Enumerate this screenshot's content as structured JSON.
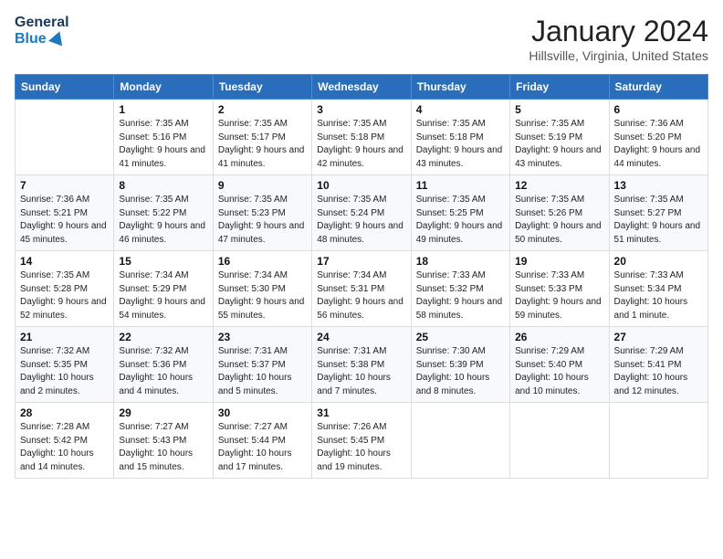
{
  "logo": {
    "line1": "General",
    "line2": "Blue"
  },
  "title": "January 2024",
  "location": "Hillsville, Virginia, United States",
  "weekdays": [
    "Sunday",
    "Monday",
    "Tuesday",
    "Wednesday",
    "Thursday",
    "Friday",
    "Saturday"
  ],
  "weeks": [
    [
      {
        "day": "",
        "sunrise": "",
        "sunset": "",
        "daylight": ""
      },
      {
        "day": "1",
        "sunrise": "Sunrise: 7:35 AM",
        "sunset": "Sunset: 5:16 PM",
        "daylight": "Daylight: 9 hours and 41 minutes."
      },
      {
        "day": "2",
        "sunrise": "Sunrise: 7:35 AM",
        "sunset": "Sunset: 5:17 PM",
        "daylight": "Daylight: 9 hours and 41 minutes."
      },
      {
        "day": "3",
        "sunrise": "Sunrise: 7:35 AM",
        "sunset": "Sunset: 5:18 PM",
        "daylight": "Daylight: 9 hours and 42 minutes."
      },
      {
        "day": "4",
        "sunrise": "Sunrise: 7:35 AM",
        "sunset": "Sunset: 5:18 PM",
        "daylight": "Daylight: 9 hours and 43 minutes."
      },
      {
        "day": "5",
        "sunrise": "Sunrise: 7:35 AM",
        "sunset": "Sunset: 5:19 PM",
        "daylight": "Daylight: 9 hours and 43 minutes."
      },
      {
        "day": "6",
        "sunrise": "Sunrise: 7:36 AM",
        "sunset": "Sunset: 5:20 PM",
        "daylight": "Daylight: 9 hours and 44 minutes."
      }
    ],
    [
      {
        "day": "7",
        "sunrise": "Sunrise: 7:36 AM",
        "sunset": "Sunset: 5:21 PM",
        "daylight": "Daylight: 9 hours and 45 minutes."
      },
      {
        "day": "8",
        "sunrise": "Sunrise: 7:35 AM",
        "sunset": "Sunset: 5:22 PM",
        "daylight": "Daylight: 9 hours and 46 minutes."
      },
      {
        "day": "9",
        "sunrise": "Sunrise: 7:35 AM",
        "sunset": "Sunset: 5:23 PM",
        "daylight": "Daylight: 9 hours and 47 minutes."
      },
      {
        "day": "10",
        "sunrise": "Sunrise: 7:35 AM",
        "sunset": "Sunset: 5:24 PM",
        "daylight": "Daylight: 9 hours and 48 minutes."
      },
      {
        "day": "11",
        "sunrise": "Sunrise: 7:35 AM",
        "sunset": "Sunset: 5:25 PM",
        "daylight": "Daylight: 9 hours and 49 minutes."
      },
      {
        "day": "12",
        "sunrise": "Sunrise: 7:35 AM",
        "sunset": "Sunset: 5:26 PM",
        "daylight": "Daylight: 9 hours and 50 minutes."
      },
      {
        "day": "13",
        "sunrise": "Sunrise: 7:35 AM",
        "sunset": "Sunset: 5:27 PM",
        "daylight": "Daylight: 9 hours and 51 minutes."
      }
    ],
    [
      {
        "day": "14",
        "sunrise": "Sunrise: 7:35 AM",
        "sunset": "Sunset: 5:28 PM",
        "daylight": "Daylight: 9 hours and 52 minutes."
      },
      {
        "day": "15",
        "sunrise": "Sunrise: 7:34 AM",
        "sunset": "Sunset: 5:29 PM",
        "daylight": "Daylight: 9 hours and 54 minutes."
      },
      {
        "day": "16",
        "sunrise": "Sunrise: 7:34 AM",
        "sunset": "Sunset: 5:30 PM",
        "daylight": "Daylight: 9 hours and 55 minutes."
      },
      {
        "day": "17",
        "sunrise": "Sunrise: 7:34 AM",
        "sunset": "Sunset: 5:31 PM",
        "daylight": "Daylight: 9 hours and 56 minutes."
      },
      {
        "day": "18",
        "sunrise": "Sunrise: 7:33 AM",
        "sunset": "Sunset: 5:32 PM",
        "daylight": "Daylight: 9 hours and 58 minutes."
      },
      {
        "day": "19",
        "sunrise": "Sunrise: 7:33 AM",
        "sunset": "Sunset: 5:33 PM",
        "daylight": "Daylight: 9 hours and 59 minutes."
      },
      {
        "day": "20",
        "sunrise": "Sunrise: 7:33 AM",
        "sunset": "Sunset: 5:34 PM",
        "daylight": "Daylight: 10 hours and 1 minute."
      }
    ],
    [
      {
        "day": "21",
        "sunrise": "Sunrise: 7:32 AM",
        "sunset": "Sunset: 5:35 PM",
        "daylight": "Daylight: 10 hours and 2 minutes."
      },
      {
        "day": "22",
        "sunrise": "Sunrise: 7:32 AM",
        "sunset": "Sunset: 5:36 PM",
        "daylight": "Daylight: 10 hours and 4 minutes."
      },
      {
        "day": "23",
        "sunrise": "Sunrise: 7:31 AM",
        "sunset": "Sunset: 5:37 PM",
        "daylight": "Daylight: 10 hours and 5 minutes."
      },
      {
        "day": "24",
        "sunrise": "Sunrise: 7:31 AM",
        "sunset": "Sunset: 5:38 PM",
        "daylight": "Daylight: 10 hours and 7 minutes."
      },
      {
        "day": "25",
        "sunrise": "Sunrise: 7:30 AM",
        "sunset": "Sunset: 5:39 PM",
        "daylight": "Daylight: 10 hours and 8 minutes."
      },
      {
        "day": "26",
        "sunrise": "Sunrise: 7:29 AM",
        "sunset": "Sunset: 5:40 PM",
        "daylight": "Daylight: 10 hours and 10 minutes."
      },
      {
        "day": "27",
        "sunrise": "Sunrise: 7:29 AM",
        "sunset": "Sunset: 5:41 PM",
        "daylight": "Daylight: 10 hours and 12 minutes."
      }
    ],
    [
      {
        "day": "28",
        "sunrise": "Sunrise: 7:28 AM",
        "sunset": "Sunset: 5:42 PM",
        "daylight": "Daylight: 10 hours and 14 minutes."
      },
      {
        "day": "29",
        "sunrise": "Sunrise: 7:27 AM",
        "sunset": "Sunset: 5:43 PM",
        "daylight": "Daylight: 10 hours and 15 minutes."
      },
      {
        "day": "30",
        "sunrise": "Sunrise: 7:27 AM",
        "sunset": "Sunset: 5:44 PM",
        "daylight": "Daylight: 10 hours and 17 minutes."
      },
      {
        "day": "31",
        "sunrise": "Sunrise: 7:26 AM",
        "sunset": "Sunset: 5:45 PM",
        "daylight": "Daylight: 10 hours and 19 minutes."
      },
      {
        "day": "",
        "sunrise": "",
        "sunset": "",
        "daylight": ""
      },
      {
        "day": "",
        "sunrise": "",
        "sunset": "",
        "daylight": ""
      },
      {
        "day": "",
        "sunrise": "",
        "sunset": "",
        "daylight": ""
      }
    ]
  ]
}
